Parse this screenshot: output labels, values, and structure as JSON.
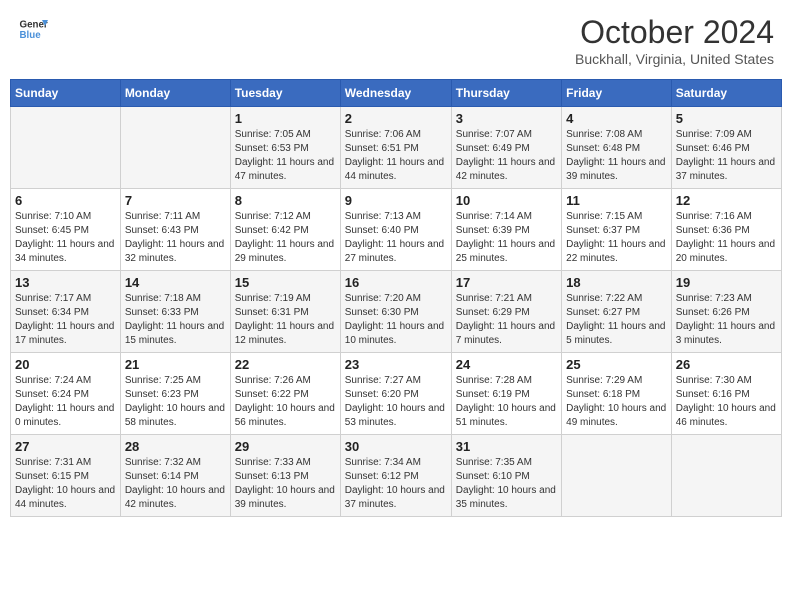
{
  "header": {
    "logo_line1": "General",
    "logo_line2": "Blue",
    "month_title": "October 2024",
    "location": "Buckhall, Virginia, United States"
  },
  "weekdays": [
    "Sunday",
    "Monday",
    "Tuesday",
    "Wednesday",
    "Thursday",
    "Friday",
    "Saturday"
  ],
  "weeks": [
    [
      {
        "day": "",
        "sunrise": "",
        "sunset": "",
        "daylight": ""
      },
      {
        "day": "",
        "sunrise": "",
        "sunset": "",
        "daylight": ""
      },
      {
        "day": "1",
        "sunrise": "Sunrise: 7:05 AM",
        "sunset": "Sunset: 6:53 PM",
        "daylight": "Daylight: 11 hours and 47 minutes."
      },
      {
        "day": "2",
        "sunrise": "Sunrise: 7:06 AM",
        "sunset": "Sunset: 6:51 PM",
        "daylight": "Daylight: 11 hours and 44 minutes."
      },
      {
        "day": "3",
        "sunrise": "Sunrise: 7:07 AM",
        "sunset": "Sunset: 6:49 PM",
        "daylight": "Daylight: 11 hours and 42 minutes."
      },
      {
        "day": "4",
        "sunrise": "Sunrise: 7:08 AM",
        "sunset": "Sunset: 6:48 PM",
        "daylight": "Daylight: 11 hours and 39 minutes."
      },
      {
        "day": "5",
        "sunrise": "Sunrise: 7:09 AM",
        "sunset": "Sunset: 6:46 PM",
        "daylight": "Daylight: 11 hours and 37 minutes."
      }
    ],
    [
      {
        "day": "6",
        "sunrise": "Sunrise: 7:10 AM",
        "sunset": "Sunset: 6:45 PM",
        "daylight": "Daylight: 11 hours and 34 minutes."
      },
      {
        "day": "7",
        "sunrise": "Sunrise: 7:11 AM",
        "sunset": "Sunset: 6:43 PM",
        "daylight": "Daylight: 11 hours and 32 minutes."
      },
      {
        "day": "8",
        "sunrise": "Sunrise: 7:12 AM",
        "sunset": "Sunset: 6:42 PM",
        "daylight": "Daylight: 11 hours and 29 minutes."
      },
      {
        "day": "9",
        "sunrise": "Sunrise: 7:13 AM",
        "sunset": "Sunset: 6:40 PM",
        "daylight": "Daylight: 11 hours and 27 minutes."
      },
      {
        "day": "10",
        "sunrise": "Sunrise: 7:14 AM",
        "sunset": "Sunset: 6:39 PM",
        "daylight": "Daylight: 11 hours and 25 minutes."
      },
      {
        "day": "11",
        "sunrise": "Sunrise: 7:15 AM",
        "sunset": "Sunset: 6:37 PM",
        "daylight": "Daylight: 11 hours and 22 minutes."
      },
      {
        "day": "12",
        "sunrise": "Sunrise: 7:16 AM",
        "sunset": "Sunset: 6:36 PM",
        "daylight": "Daylight: 11 hours and 20 minutes."
      }
    ],
    [
      {
        "day": "13",
        "sunrise": "Sunrise: 7:17 AM",
        "sunset": "Sunset: 6:34 PM",
        "daylight": "Daylight: 11 hours and 17 minutes."
      },
      {
        "day": "14",
        "sunrise": "Sunrise: 7:18 AM",
        "sunset": "Sunset: 6:33 PM",
        "daylight": "Daylight: 11 hours and 15 minutes."
      },
      {
        "day": "15",
        "sunrise": "Sunrise: 7:19 AM",
        "sunset": "Sunset: 6:31 PM",
        "daylight": "Daylight: 11 hours and 12 minutes."
      },
      {
        "day": "16",
        "sunrise": "Sunrise: 7:20 AM",
        "sunset": "Sunset: 6:30 PM",
        "daylight": "Daylight: 11 hours and 10 minutes."
      },
      {
        "day": "17",
        "sunrise": "Sunrise: 7:21 AM",
        "sunset": "Sunset: 6:29 PM",
        "daylight": "Daylight: 11 hours and 7 minutes."
      },
      {
        "day": "18",
        "sunrise": "Sunrise: 7:22 AM",
        "sunset": "Sunset: 6:27 PM",
        "daylight": "Daylight: 11 hours and 5 minutes."
      },
      {
        "day": "19",
        "sunrise": "Sunrise: 7:23 AM",
        "sunset": "Sunset: 6:26 PM",
        "daylight": "Daylight: 11 hours and 3 minutes."
      }
    ],
    [
      {
        "day": "20",
        "sunrise": "Sunrise: 7:24 AM",
        "sunset": "Sunset: 6:24 PM",
        "daylight": "Daylight: 11 hours and 0 minutes."
      },
      {
        "day": "21",
        "sunrise": "Sunrise: 7:25 AM",
        "sunset": "Sunset: 6:23 PM",
        "daylight": "Daylight: 10 hours and 58 minutes."
      },
      {
        "day": "22",
        "sunrise": "Sunrise: 7:26 AM",
        "sunset": "Sunset: 6:22 PM",
        "daylight": "Daylight: 10 hours and 56 minutes."
      },
      {
        "day": "23",
        "sunrise": "Sunrise: 7:27 AM",
        "sunset": "Sunset: 6:20 PM",
        "daylight": "Daylight: 10 hours and 53 minutes."
      },
      {
        "day": "24",
        "sunrise": "Sunrise: 7:28 AM",
        "sunset": "Sunset: 6:19 PM",
        "daylight": "Daylight: 10 hours and 51 minutes."
      },
      {
        "day": "25",
        "sunrise": "Sunrise: 7:29 AM",
        "sunset": "Sunset: 6:18 PM",
        "daylight": "Daylight: 10 hours and 49 minutes."
      },
      {
        "day": "26",
        "sunrise": "Sunrise: 7:30 AM",
        "sunset": "Sunset: 6:16 PM",
        "daylight": "Daylight: 10 hours and 46 minutes."
      }
    ],
    [
      {
        "day": "27",
        "sunrise": "Sunrise: 7:31 AM",
        "sunset": "Sunset: 6:15 PM",
        "daylight": "Daylight: 10 hours and 44 minutes."
      },
      {
        "day": "28",
        "sunrise": "Sunrise: 7:32 AM",
        "sunset": "Sunset: 6:14 PM",
        "daylight": "Daylight: 10 hours and 42 minutes."
      },
      {
        "day": "29",
        "sunrise": "Sunrise: 7:33 AM",
        "sunset": "Sunset: 6:13 PM",
        "daylight": "Daylight: 10 hours and 39 minutes."
      },
      {
        "day": "30",
        "sunrise": "Sunrise: 7:34 AM",
        "sunset": "Sunset: 6:12 PM",
        "daylight": "Daylight: 10 hours and 37 minutes."
      },
      {
        "day": "31",
        "sunrise": "Sunrise: 7:35 AM",
        "sunset": "Sunset: 6:10 PM",
        "daylight": "Daylight: 10 hours and 35 minutes."
      },
      {
        "day": "",
        "sunrise": "",
        "sunset": "",
        "daylight": ""
      },
      {
        "day": "",
        "sunrise": "",
        "sunset": "",
        "daylight": ""
      }
    ]
  ]
}
